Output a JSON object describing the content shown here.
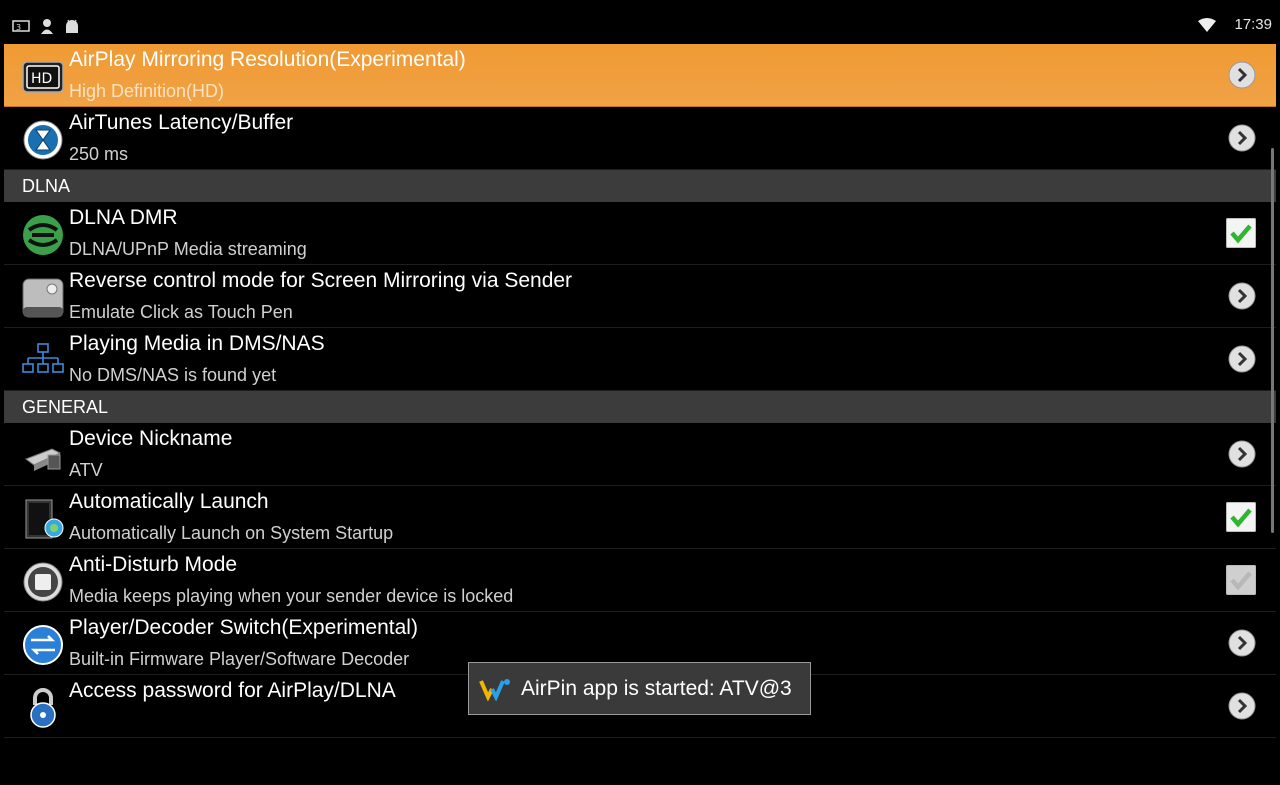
{
  "status_bar": {
    "time": "17:39",
    "left_icons": [
      "media-icon",
      "person-icon",
      "android-icon"
    ],
    "right_icons": [
      "wifi-icon"
    ]
  },
  "rows_top": [
    {
      "id": "airplay-resolution",
      "title": "AirPlay Mirroring Resolution(Experimental)",
      "subtitle": "High Definition(HD)",
      "icon": "hd-icon",
      "control": "arrow",
      "selected": true
    },
    {
      "id": "airtunes-latency",
      "title": "AirTunes Latency/Buffer",
      "subtitle": "250 ms",
      "icon": "hourglass-icon",
      "control": "arrow"
    }
  ],
  "sections": {
    "dlna": "DLNA",
    "general": "GENERAL"
  },
  "rows_dlna": [
    {
      "id": "dlna-dmr",
      "title": "DLNA DMR",
      "subtitle": "DLNA/UPnP Media streaming",
      "icon": "dlna-icon",
      "control": "checkbox",
      "checked": true
    },
    {
      "id": "reverse-control",
      "title": "Reverse control mode for Screen Mirroring via Sender",
      "subtitle": "Emulate Click as Touch Pen",
      "icon": "touch-pen-icon",
      "control": "arrow"
    },
    {
      "id": "playing-media",
      "title": "Playing Media in DMS/NAS",
      "subtitle": "No DMS/NAS is found yet",
      "icon": "network-tree-icon",
      "control": "arrow"
    }
  ],
  "rows_general": [
    {
      "id": "device-nickname",
      "title": "Device Nickname",
      "subtitle": "ATV",
      "icon": "device-icon",
      "control": "arrow"
    },
    {
      "id": "auto-launch",
      "title": "Automatically Launch",
      "subtitle": "Automatically Launch on System Startup",
      "icon": "launch-icon",
      "control": "checkbox",
      "checked": true
    },
    {
      "id": "anti-disturb",
      "title": "Anti-Disturb Mode",
      "subtitle": "Media keeps playing when your sender device is locked",
      "icon": "lock-screen-icon",
      "control": "checkbox",
      "checked": true,
      "disabled": true
    },
    {
      "id": "player-decoder",
      "title": "Player/Decoder Switch(Experimental)",
      "subtitle": "Built-in Firmware Player/Software Decoder",
      "icon": "switch-icon",
      "control": "arrow"
    },
    {
      "id": "access-password",
      "title": "Access password for AirPlay/DLNA",
      "subtitle": "",
      "icon": "padlock-icon",
      "control": "arrow"
    }
  ],
  "toast": {
    "text": "AirPin app is started: ATV@3",
    "icon": "airpin-logo-icon"
  },
  "colors": {
    "selected_row": "#f09a33",
    "section_header": "#3c3c3c",
    "check_green": "#2fb52f"
  }
}
